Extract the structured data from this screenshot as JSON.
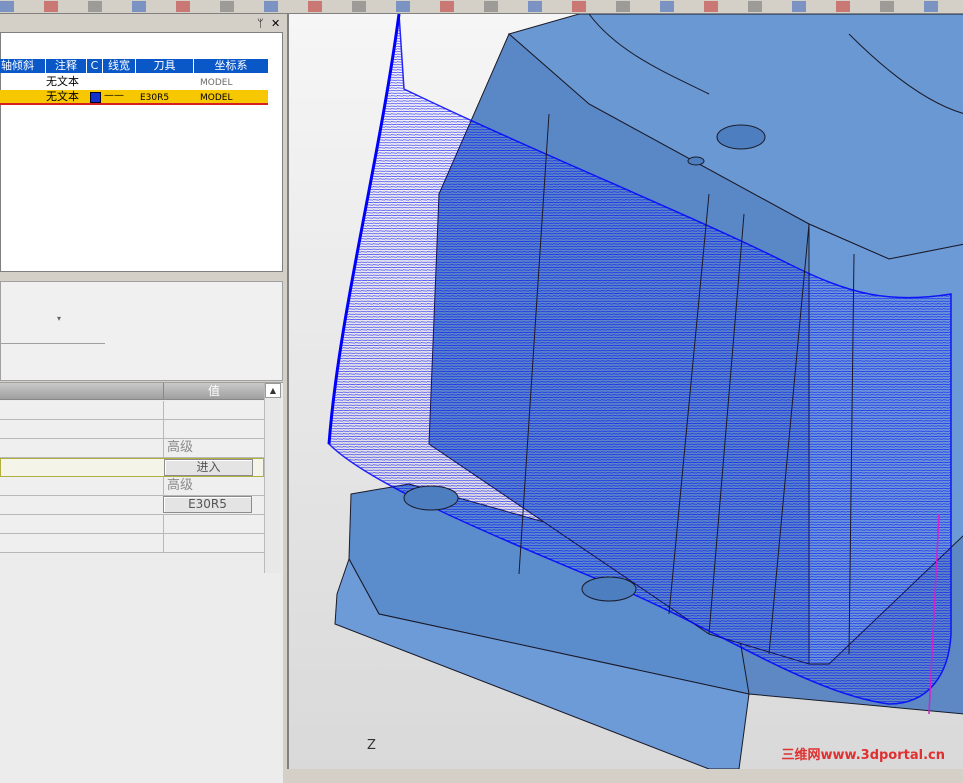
{
  "toolbar": {
    "icons": [
      "axes-icon",
      "curve-icon",
      "undo-icon",
      "arrow-icon",
      "filter-icon",
      "tool-icon",
      "book-icon",
      "list-icon",
      "display-icon",
      "rect-icon",
      "circle-icon",
      "gear-icon",
      "folder-icon",
      "tree-icon",
      "network-icon",
      "preview-icon",
      "star-icon",
      "line-icon",
      "cross-icon",
      "cursor-icon",
      "bar-icon",
      "pin-icon"
    ]
  },
  "ops_panel": {
    "pin_glyph": "ᛘ",
    "close_glyph": "✕",
    "columns": [
      "轴倾斜",
      "注释",
      "C",
      "线宽",
      "刀具",
      "坐标系"
    ],
    "rows": [
      {
        "note": "无文本",
        "coord": "MODEL"
      },
      {
        "note": "无文本",
        "line": "——",
        "tool": "E30R5",
        "coord": "MODEL",
        "color": "#1030d0"
      }
    ]
  },
  "mid_panel": {
    "dropdown_glyph": "▾"
  },
  "props": {
    "value_header": "值",
    "rows": [
      {
        "value": ""
      },
      {
        "value": ""
      },
      {
        "value": "高级"
      },
      {
        "button": "进入"
      },
      {
        "value": "高级"
      },
      {
        "button": "E30R5"
      },
      {
        "value": ""
      },
      {
        "value": ""
      }
    ],
    "scroll_up": "▲"
  },
  "viewport": {
    "axis_label": "Z",
    "watermark": "三维网www.3dportal.cn",
    "colors": {
      "part": "#5f8fcf",
      "toolpath": "#0000ff",
      "edge": "#1a1a2a"
    }
  }
}
